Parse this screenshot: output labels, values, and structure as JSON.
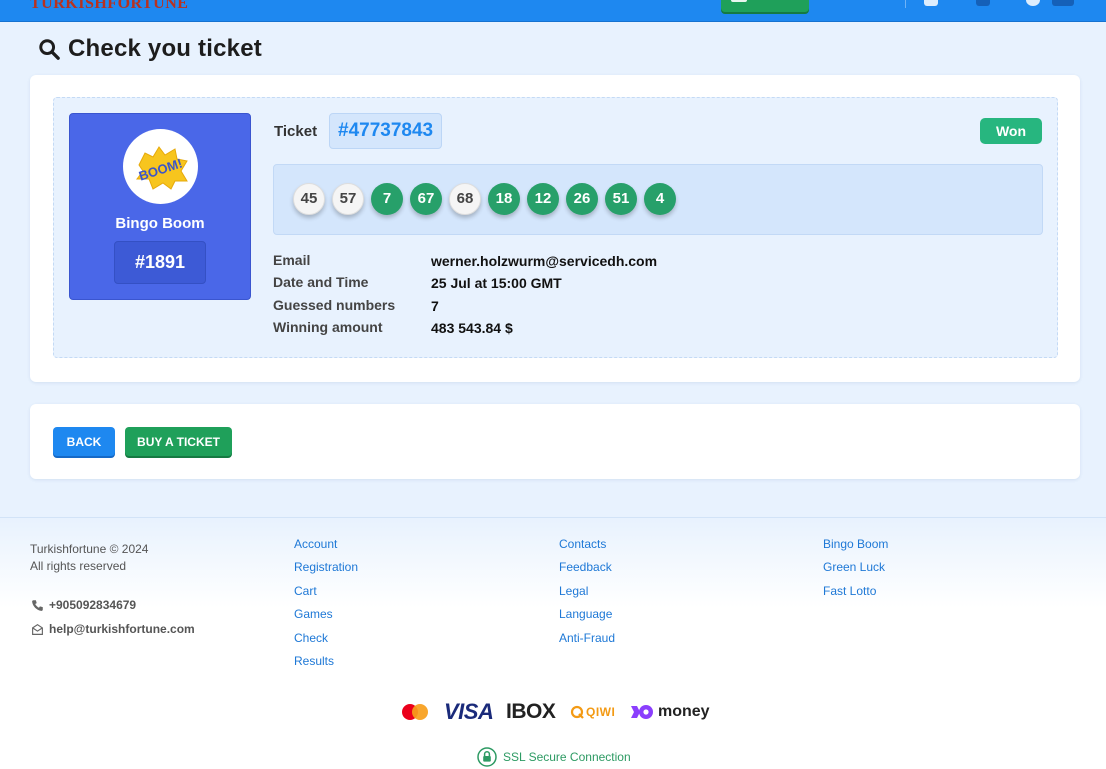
{
  "header": {
    "logo_text": "TURKISHFORTUNE"
  },
  "page": {
    "title": "Check you ticket"
  },
  "game": {
    "name": "Bingo Boom",
    "draw_number": "#1891",
    "logo_text": "BOOM!"
  },
  "ticket": {
    "label": "Ticket",
    "number": "#47737843",
    "status": "Won",
    "balls": [
      {
        "value": "45",
        "hit": false
      },
      {
        "value": "57",
        "hit": false
      },
      {
        "value": "7",
        "hit": true
      },
      {
        "value": "67",
        "hit": true
      },
      {
        "value": "68",
        "hit": false
      },
      {
        "value": "18",
        "hit": true
      },
      {
        "value": "12",
        "hit": true
      },
      {
        "value": "26",
        "hit": true
      },
      {
        "value": "51",
        "hit": true
      },
      {
        "value": "4",
        "hit": true
      }
    ],
    "details": [
      {
        "label": "Email",
        "value": "werner.holzwurm@servicedh.com"
      },
      {
        "label": "Date and Time",
        "value": "25 Jul at 15:00 GMT"
      },
      {
        "label": "Guessed numbers",
        "value": "7"
      },
      {
        "label": "Winning amount",
        "value": "483 543.84 $"
      }
    ]
  },
  "actions": {
    "back_label": "BACK",
    "buy_label": "BUY A TICKET"
  },
  "footer": {
    "copyright": "Turkishfortune © 2024",
    "rights": "All rights reserved",
    "phone": "+905092834679",
    "email": "help@turkishfortune.com",
    "col1": [
      "Account",
      "Registration",
      "Cart",
      "Games",
      "Check",
      "Results"
    ],
    "col2": [
      "Contacts",
      "Feedback",
      "Legal",
      "Language",
      "Anti-Fraud"
    ],
    "col3": [
      "Bingo Boom",
      "Green Luck",
      "Fast Lotto"
    ],
    "payments": {
      "visa": "VISA",
      "ibox": "IBOX",
      "qiwi": "QIWI",
      "money": "money"
    },
    "ssl_text": "SSL Secure Connection"
  },
  "colors": {
    "header_blue": "#1e88f0",
    "brand_green": "#1fa05a",
    "won_green": "#27b67f",
    "game_tile_blue": "#4a67e8",
    "link_blue": "#1e78d6"
  }
}
